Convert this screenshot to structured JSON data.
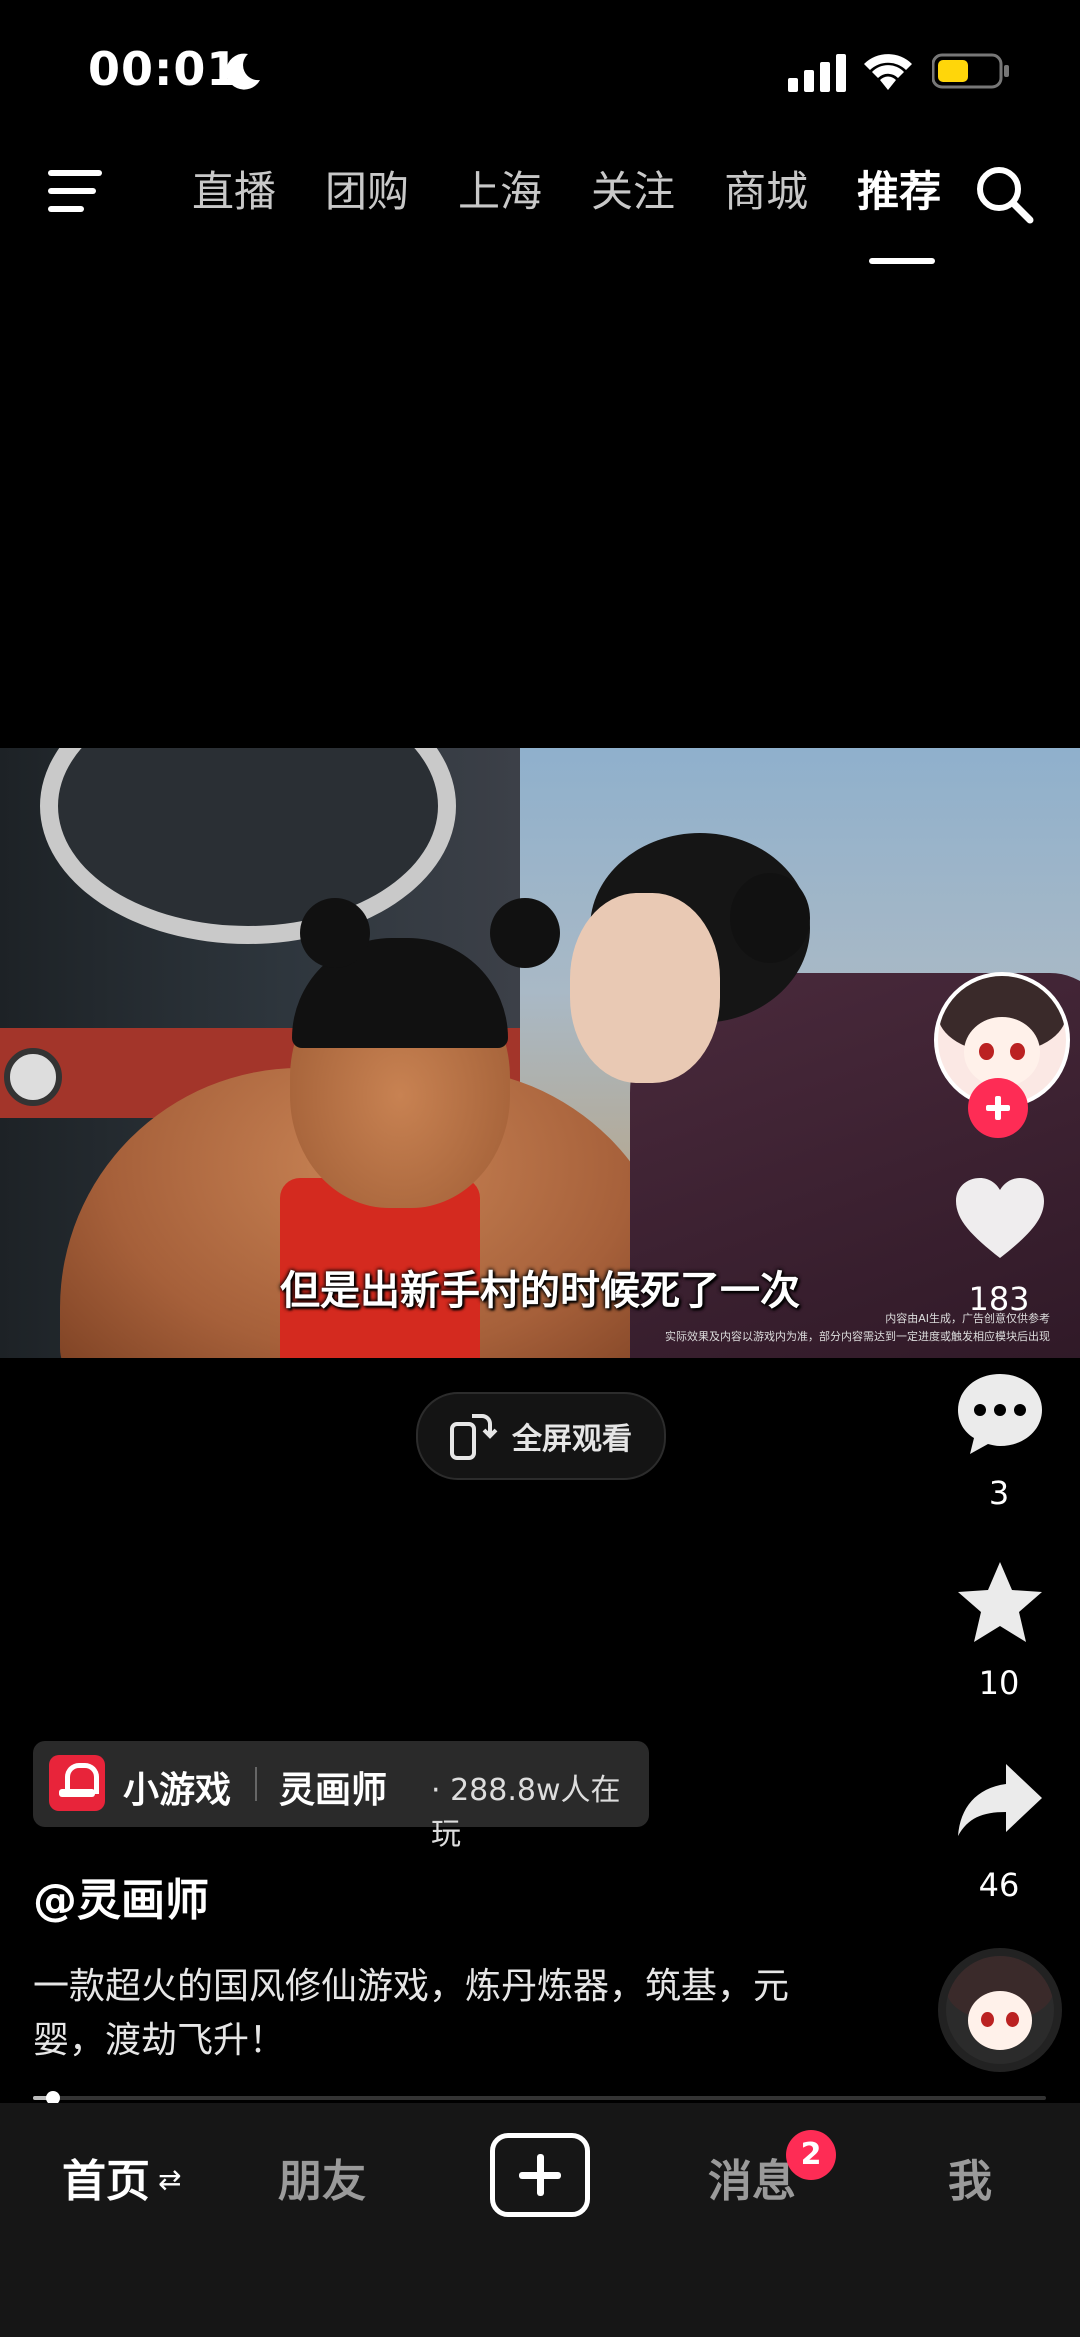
{
  "status_bar": {
    "time": "00:01"
  },
  "top_nav": {
    "tabs": [
      {
        "label": "直播",
        "active": false
      },
      {
        "label": "团购",
        "active": false
      },
      {
        "label": "上海",
        "active": false
      },
      {
        "label": "关注",
        "active": false
      },
      {
        "label": "商城",
        "active": false
      },
      {
        "label": "推荐",
        "active": true
      }
    ]
  },
  "video": {
    "subtitle": "但是出新手村的时候死了一次",
    "disclaimer_line1": "内容由AI生成，广告创意仅供参考",
    "disclaimer_line2": "实际效果及内容以游戏内为准，部分内容需达到一定进度或触发相应模块后出现",
    "fullscreen_label": "全屏观看"
  },
  "actions": {
    "likes": "183",
    "comments": "3",
    "favorites": "10",
    "shares": "46"
  },
  "mini_game": {
    "type_label": "小游戏",
    "name": "灵画师",
    "players": "· 288.8w人在玩"
  },
  "post": {
    "author": "@灵画师",
    "description": "一款超火的国风修仙游戏，炼丹炼器，筑基，元婴，渡劫飞升！",
    "progress": 0.02
  },
  "bottom_nav": {
    "home": "首页",
    "friends": "朋友",
    "messages": "消息",
    "messages_badge": "2",
    "me": "我"
  },
  "colors": {
    "accent": "#fe2c55",
    "battery": "#ffd60a",
    "background": "#000000"
  }
}
